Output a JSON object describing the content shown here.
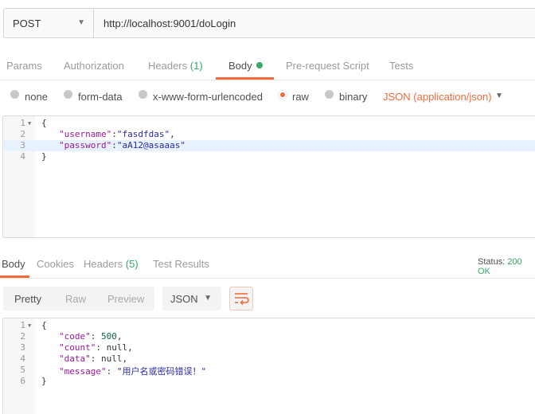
{
  "request": {
    "method": "POST",
    "url": "http://localhost:9001/doLogin"
  },
  "tabs": [
    {
      "label": "Params"
    },
    {
      "label": "Authorization"
    },
    {
      "label": "Headers",
      "count": "(1)"
    },
    {
      "label": "Body"
    },
    {
      "label": "Pre-request Script"
    },
    {
      "label": "Tests"
    }
  ],
  "body_types": {
    "none": "none",
    "form_data": "form-data",
    "urlencoded": "x-www-form-urlencoded",
    "raw": "raw",
    "binary": "binary",
    "format": "JSON (application/json)"
  },
  "request_body": {
    "line_numbers": [
      "1",
      "2",
      "3",
      "4"
    ],
    "l1": "{",
    "l2_key": "\"username\"",
    "l2_sep": ":",
    "l2_val": "\"fasdfdas\"",
    "l2_end": ",",
    "l3_key": "\"password\"",
    "l3_sep": ":",
    "l3_val": "\"aA12@asaaas\"",
    "l4": "}"
  },
  "response_tabs": [
    {
      "label": "Body"
    },
    {
      "label": "Cookies"
    },
    {
      "label": "Headers",
      "count": "(5)"
    },
    {
      "label": "Test Results"
    }
  ],
  "status": {
    "label": "Status:",
    "value": "200 OK"
  },
  "view_modes": [
    "Pretty",
    "Raw",
    "Preview"
  ],
  "response_format": "JSON",
  "response_body": {
    "line_numbers": [
      "1",
      "2",
      "3",
      "4",
      "5",
      "6"
    ],
    "l1": "{",
    "l2_key": "\"code\"",
    "l2_val": "500",
    "l3_key": "\"count\"",
    "l3_val": "null",
    "l4_key": "\"data\"",
    "l4_val": "null",
    "l5_key": "\"message\"",
    "l5_val": "\"用户名或密码错误！\"",
    "l6": "}"
  },
  "colors": {
    "accent": "#f26b3a",
    "success": "#38a769"
  },
  "icons": {
    "method_dropdown": "chevron-down-icon",
    "format_dropdown": "chevron-down-icon",
    "wrap": "wrap-lines-icon",
    "fold": "fold-arrow-icon"
  }
}
